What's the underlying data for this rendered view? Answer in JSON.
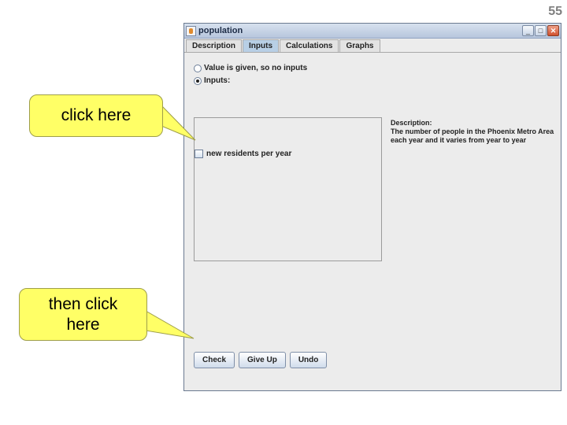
{
  "slide": {
    "number": "55"
  },
  "window": {
    "title": "population",
    "controls": {
      "minimize": "_",
      "maximize": "□",
      "close": "✕"
    }
  },
  "tabs": [
    {
      "label": "Description",
      "active": false
    },
    {
      "label": "Inputs",
      "active": true
    },
    {
      "label": "Calculations",
      "active": false
    },
    {
      "label": "Graphs",
      "active": false
    }
  ],
  "options": {
    "value_given": {
      "label": "Value is given, so no inputs",
      "checked": false
    },
    "inputs": {
      "label": "Inputs:",
      "checked": true
    }
  },
  "input_list": [
    {
      "label": "new residents per year",
      "checked": false
    }
  ],
  "description": {
    "heading": "Description:",
    "text": "The number of people in the Phoenix Metro Area each year and it varies from year to year"
  },
  "buttons": {
    "check": "Check",
    "give_up": "Give Up",
    "undo": "Undo"
  },
  "callouts": {
    "first": "click here",
    "second": "then click here",
    "color": "#ffff66"
  }
}
